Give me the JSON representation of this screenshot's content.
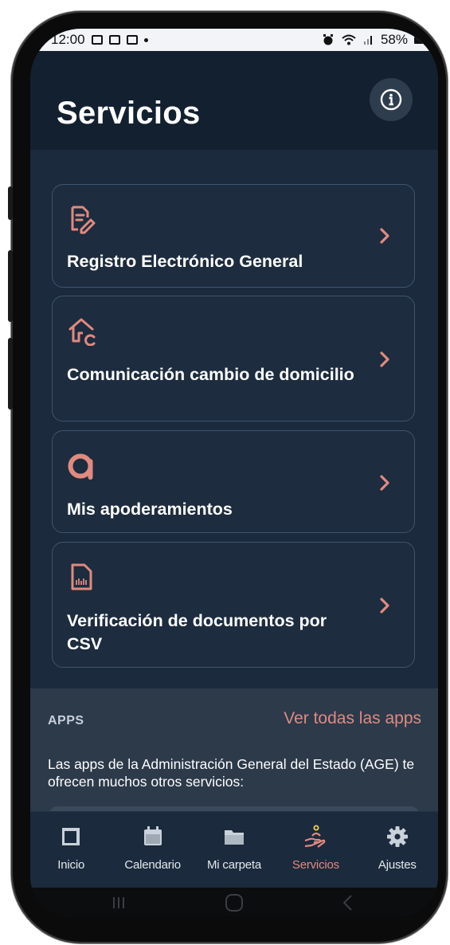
{
  "status_bar": {
    "time": "12:00",
    "battery": "58%"
  },
  "header": {
    "title": "Servicios",
    "info_icon": "info-icon"
  },
  "services": [
    {
      "title": "Registro Electrónico General",
      "icon": "document-edit-icon"
    },
    {
      "title": "Comunicación cambio de domicilio",
      "icon": "house-change-icon"
    },
    {
      "title": "Mis apoderamientos",
      "icon": "apoderamientos-logo-icon"
    },
    {
      "title": "Verificación de documentos por CSV",
      "icon": "document-barcode-icon"
    }
  ],
  "apps": {
    "section_title": "APPS",
    "link": "Ver todas las apps",
    "description": "Las apps de la Administración General del Estado (AGE) te ofrecen muchos otros servicios:"
  },
  "tabs": [
    {
      "label": "Inicio",
      "icon": "home-square-icon",
      "active": false
    },
    {
      "label": "Calendario",
      "icon": "calendar-icon",
      "active": false
    },
    {
      "label": "Mi carpeta",
      "icon": "folder-icon",
      "active": false
    },
    {
      "label": "Servicios",
      "icon": "hand-service-icon",
      "active": true
    },
    {
      "label": "Ajustes",
      "icon": "gear-icon",
      "active": false
    }
  ],
  "colors": {
    "accent": "#e08a80",
    "background": "#1b2a3c",
    "header_bg": "#13202f",
    "card_border": "#3f5570"
  }
}
